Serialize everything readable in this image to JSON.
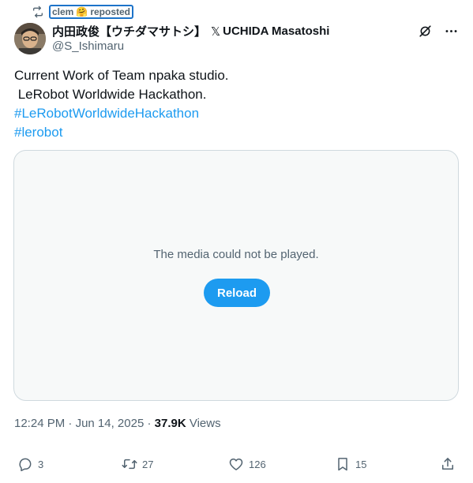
{
  "repost": {
    "user": "clem",
    "emoji": "🤗",
    "label": "reposted"
  },
  "author": {
    "display_name": "内田政俊【ウチダマサトシ】",
    "x_mark": "𝕏",
    "name_suffix": "UCHIDA Masatoshi",
    "handle": "@S_Ishimaru"
  },
  "post": {
    "line1": "Current Work of Team npaka studio.",
    "line2": " LeRobot Worldwide Hackathon.",
    "hashtag1": "#LeRobotWorldwideHackathon",
    "hashtag2": "#lerobot"
  },
  "media": {
    "message": "The media could not be played.",
    "reload_label": "Reload"
  },
  "meta": {
    "time": "12:24 PM",
    "separator": " · ",
    "date": "Jun 14, 2025",
    "views_count": "37.9K",
    "views_label": "Views"
  },
  "actions": {
    "replies": "3",
    "reposts": "27",
    "likes": "126",
    "bookmarks": "15"
  },
  "colors": {
    "accent": "#1d9bf0",
    "muted": "#536471"
  }
}
